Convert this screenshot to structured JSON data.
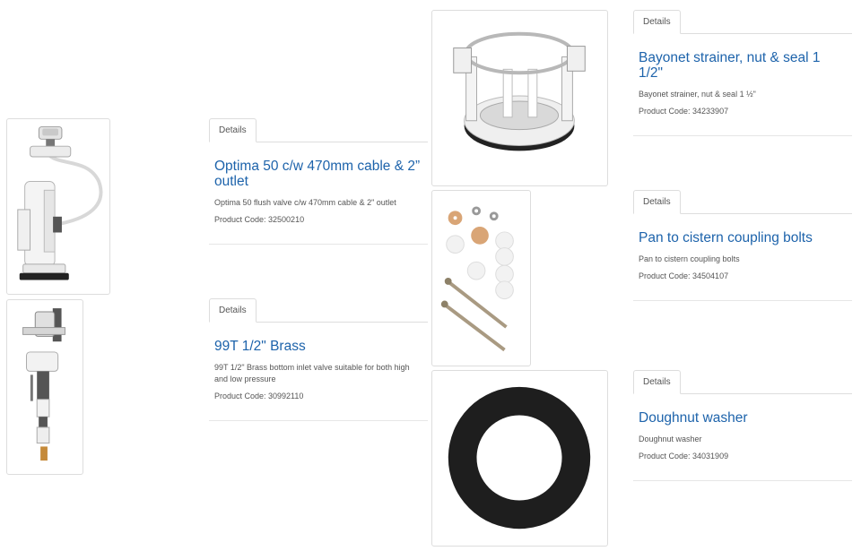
{
  "products": [
    {
      "tab_label": "Details",
      "title": "Optima 50 c/w 470mm cable & 2” outlet",
      "description": "Optima 50 flush valve c/w 470mm cable & 2\" outlet",
      "product_code": "Product Code: 32500210"
    },
    {
      "tab_label": "Details",
      "title": "99T 1/2\" Brass",
      "description": "99T 1/2\" Brass bottom inlet valve suitable for both high and low pressure",
      "product_code": "Product Code: 30992110"
    },
    {
      "tab_label": "Details",
      "title": "Bayonet strainer, nut & seal 1 1/2\"",
      "description": "Bayonet strainer, nut & seal 1 ½\"",
      "product_code": "Product Code: 34233907"
    },
    {
      "tab_label": "Details",
      "title": "Pan to cistern coupling bolts",
      "description": "Pan to cistern coupling bolts",
      "product_code": "Product Code: 34504107"
    },
    {
      "tab_label": "Details",
      "title": "Doughnut washer",
      "description": "Doughnut washer",
      "product_code": "Product Code: 34031909"
    }
  ],
  "images": {
    "flush_valve": "flush-valve-icon",
    "fill_valve": "fill-valve-icon",
    "strainer": "bayonet-strainer-icon",
    "bolts": "coupling-bolts-icon",
    "washer": "doughnut-washer-icon"
  }
}
